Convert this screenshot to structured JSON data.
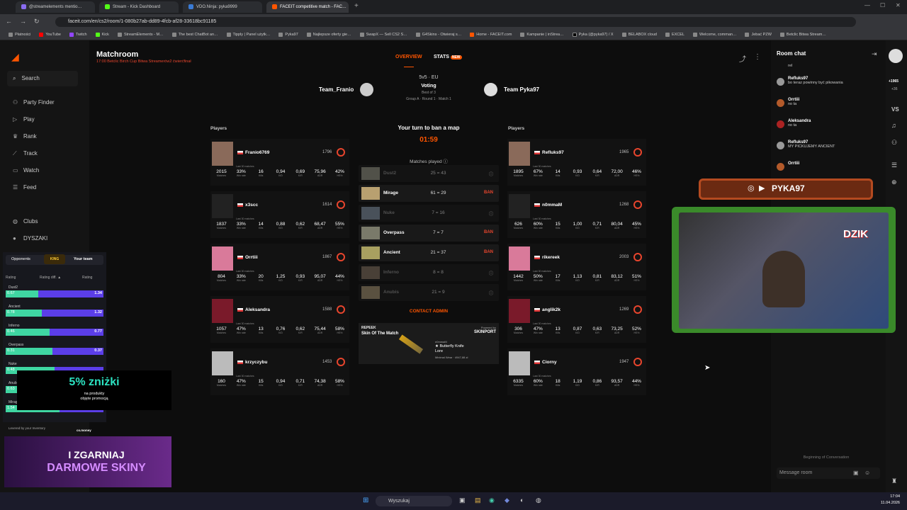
{
  "browser": {
    "tabs": [
      {
        "label": "@streamelements mentio…",
        "color": "#8a6cf0"
      },
      {
        "label": "Stream - Kick Dashboard",
        "color": "#53fc18"
      },
      {
        "label": "VDO.Ninja: pyka9999",
        "color": "#3a7bd5"
      },
      {
        "label": "FACEIT competitive match - FAC…",
        "color": "#ff5500"
      }
    ],
    "url": "faceit.com/en/cs2/room/1-080b27ab-dd89-4fcb-af28-33618bc91185",
    "bookmarks": [
      "Płatności",
      "YouTube",
      "Twitch",
      "Kick",
      "StreamElements - M…",
      "The best ChatBot an…",
      "Tipply | Panel użytk…",
      "Pyka97",
      "Najlepsze oferty gie…",
      "SwapX — Sell CS2 S…",
      "G4Skins - Otwieraj s…",
      "Home - FACEIT.com",
      "Kampanie | inStrea…",
      "Pyka (@pyka97) / X",
      "BELABOX cloud",
      "EXCEL",
      "Welcome, comman…",
      "Jebać PZW",
      "Betclic Bitwa Stream…"
    ]
  },
  "sidebar": {
    "search": "Search",
    "items": [
      "Party Finder",
      "Play",
      "Rank",
      "Track",
      "Watch",
      "Feed"
    ],
    "clubs": "Clubs",
    "club_name": "DYSZAKI"
  },
  "match": {
    "title": "Matchroom",
    "subtitle": "17:00 Betclic Birch Cup Bitwa Streamerów2 ćwierćfinał",
    "tab_overview": "OVERVIEW",
    "tab_stats": "STATS",
    "tab_badge": "NEW",
    "format": "5v5 · EU",
    "status": "Voting",
    "best_of": "Best of 3",
    "group": "Group A · Round 1 · Match 1",
    "team1": "Team_Franio",
    "team2": "Team Pyka97",
    "players_label": "Players",
    "ban_prompt": "Your turn to ban a map",
    "timer": "01:59",
    "matches_played": "Matches played",
    "contact": "CONTACT ADMIN",
    "stat_labels": [
      "Matches",
      "Win rate",
      "Kills",
      "K/D",
      "K/R",
      "ADR",
      "HS%"
    ],
    "last30": "Last 30 matches"
  },
  "team1_players": [
    {
      "name": "Franio6769",
      "elo": "1796",
      "stats": [
        "2015",
        "33%",
        "16",
        "0,94",
        "0,69",
        "75,96",
        "42%"
      ]
    },
    {
      "name": "x3scc",
      "elo": "1614",
      "stats": [
        "1837",
        "33%",
        "14",
        "0,88",
        "0,62",
        "68,47",
        "55%"
      ]
    },
    {
      "name": "Orrtiii",
      "elo": "1867",
      "stats": [
        "804",
        "33%",
        "20",
        "1,25",
        "0,93",
        "95,07",
        "44%"
      ]
    },
    {
      "name": "Aleksandra",
      "elo": "1588",
      "stats": [
        "1057",
        "47%",
        "13",
        "0,76",
        "0,62",
        "75,44",
        "58%"
      ]
    },
    {
      "name": "krzyczybu",
      "elo": "1453",
      "stats": [
        "160",
        "47%",
        "15",
        "0,94",
        "0,71",
        "74,38",
        "58%"
      ]
    }
  ],
  "team2_players": [
    {
      "name": "Refluks97",
      "elo": "1965",
      "stats": [
        "1895",
        "67%",
        "14",
        "0,93",
        "0,64",
        "72,00",
        "46%"
      ]
    },
    {
      "name": "n0mmaM",
      "elo": "1268",
      "stats": [
        "626",
        "60%",
        "15",
        "1,00",
        "0,71",
        "80,04",
        "45%"
      ]
    },
    {
      "name": "rikereek",
      "elo": "2003",
      "stats": [
        "1442",
        "50%",
        "17",
        "1,13",
        "0,81",
        "83,12",
        "51%"
      ]
    },
    {
      "name": "anglik2k",
      "elo": "1269",
      "stats": [
        "306",
        "47%",
        "13",
        "0,87",
        "0,63",
        "73,25",
        "52%"
      ]
    },
    {
      "name": "Ciorny",
      "elo": "1947",
      "stats": [
        "6335",
        "60%",
        "18",
        "1,19",
        "0,86",
        "93,57",
        "44%"
      ]
    }
  ],
  "maps": [
    {
      "name": "Dust2",
      "score": "25 = 43",
      "status": "",
      "dim": true
    },
    {
      "name": "Mirage",
      "score": "61 = 29",
      "status": "BAN",
      "dim": false
    },
    {
      "name": "Nuke",
      "score": "7 = 16",
      "status": "",
      "dim": true
    },
    {
      "name": "Overpass",
      "score": "7 = 7",
      "status": "BAN",
      "dim": false
    },
    {
      "name": "Ancient",
      "score": "21 = 37",
      "status": "BAN",
      "dim": false
    },
    {
      "name": "Inferno",
      "score": "8 = 8",
      "status": "",
      "dim": true
    },
    {
      "name": "Anubis",
      "score": "21 = 9",
      "status": "",
      "dim": true
    }
  ],
  "skin": {
    "brand": "REPEEK",
    "title": "Skin Of The Match",
    "powered": "Powered by",
    "sponsor": "SKINPORT",
    "owner": "n0mmaM",
    "item": "★ Butterfly Knife",
    "variant": "Lore",
    "wear": "Minimal Wear · 4947,88 zł"
  },
  "odds": {
    "left_tab": "Opponents",
    "right_tab": "Your team",
    "col_rating": "Rating",
    "col_diff": "Rating diff. ▲",
    "col_rating2": "Rating",
    "rows": [
      {
        "map": "Dust2",
        "a": "0.67",
        "b": "1.34",
        "frac": 0.33
      },
      {
        "map": "Ancient",
        "a": "0.78",
        "b": "1.32",
        "frac": 0.37
      },
      {
        "map": "Inferno",
        "a": "0.46",
        "b": "0.77",
        "frac": 0.45
      },
      {
        "map": "Overpass",
        "a": "0.31",
        "b": "0.37",
        "frac": 0.48
      },
      {
        "map": "Nuke",
        "a": "0.48",
        "b": "",
        "frac": 0.5
      },
      {
        "map": "Anubis",
        "a": "0.63",
        "b": "",
        "frac": 0.5
      },
      {
        "map": "Mirage",
        "a": "1.54",
        "b": "1.27",
        "frac": 0.55
      }
    ],
    "footer": "Levered by your Inventory",
    "footer2": "cs.money"
  },
  "promo": {
    "big": "5% zniżki",
    "small1": "na produkty",
    "small2": "objęte promocją"
  },
  "promo2": {
    "line1": "I ZGARNIAJ",
    "line2": "DARMOWE SKINY"
  },
  "overlay": {
    "handle": "PYKA97",
    "sign": "DZIK"
  },
  "chat": {
    "title": "Room chat",
    "messages": [
      {
        "user": "",
        "time": "",
        "text": "rel"
      },
      {
        "user": "Refluks97",
        "time": "17:02",
        "text": "bo teraz powinny być pikowania"
      },
      {
        "user": "Orrtiii",
        "time": "17:02",
        "text": "no ta"
      },
      {
        "user": "Aleksandra",
        "time": "17:02",
        "text": "no ta"
      },
      {
        "user": "Refluks97",
        "time": "17:03",
        "text": "MY PICKUJEMY ANCIENT"
      },
      {
        "user": "Orrtiii",
        "time": "17:03",
        "text": ""
      }
    ],
    "beginning": "Beginning of Conversation",
    "placeholder": "Message room"
  },
  "rail": {
    "points": "+1965",
    "delta": "+36",
    "vs": "VS"
  },
  "taskbar": {
    "search": "Wyszukaj",
    "time": "17:04",
    "date": "11.04.2026"
  }
}
